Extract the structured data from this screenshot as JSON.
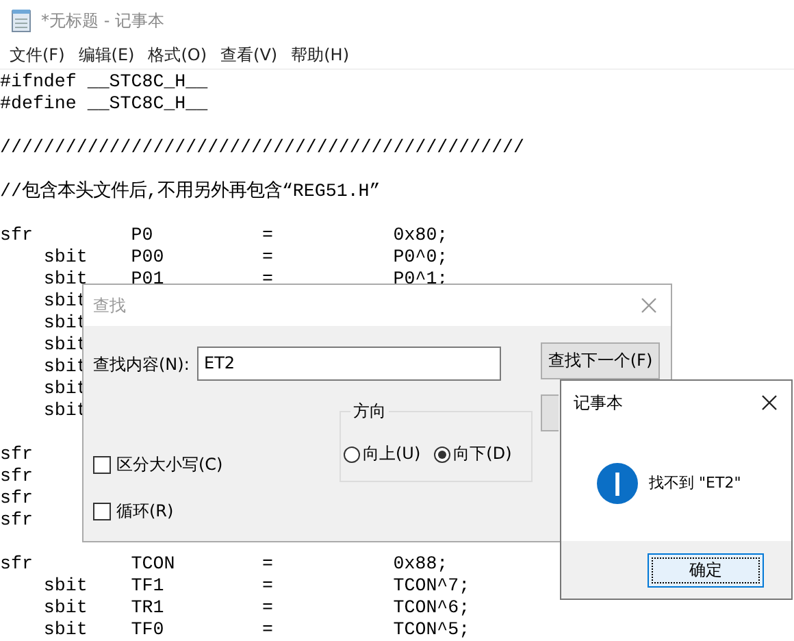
{
  "window": {
    "title": "*无标题 - 记事本"
  },
  "menu": [
    "文件(F)",
    "编辑(E)",
    "格式(O)",
    "查看(V)",
    "帮助(H)"
  ],
  "editor": {
    "blocks": [
      {
        "lines": [
          "#ifndef __STC8C_H__",
          "#define __STC8C_H__"
        ]
      },
      {
        "lines": [
          "////////////////////////////////////////////////"
        ]
      },
      {
        "lines": [
          "//包含本头文件后,不用另外再包含“REG51.H”"
        ]
      },
      {
        "lines": [
          "sfr         P0          =           0x80;",
          "    sbit    P00         =           P0^0;",
          "    sbit    P01         =           P0^1;",
          "    sbit",
          "    sbit",
          "    sbit",
          "    sbit",
          "    sbit",
          "    sbit"
        ]
      },
      {
        "lines": [
          "sfr",
          "sfr",
          "sfr",
          "sfr"
        ]
      },
      {
        "lines": [
          "sfr         TCON        =           0x88;",
          "    sbit    TF1         =           TCON^7;",
          "    sbit    TR1         =           TCON^6;",
          "    sbit    TF0         =           TCON^5;"
        ]
      }
    ]
  },
  "find_dialog": {
    "title": "查找",
    "label": "查找内容(N):",
    "value": "ET2",
    "find_next": "查找下一个(F)",
    "direction": {
      "title": "方向",
      "options": [
        {
          "label": "向上(U)",
          "selected": false
        },
        {
          "label": "向下(D)",
          "selected": true
        }
      ]
    },
    "options": [
      {
        "label": "区分大小写(C)",
        "checked": false
      },
      {
        "label": "循环(R)",
        "checked": false
      }
    ]
  },
  "message_box": {
    "title": "记事本",
    "message": "找不到 \"ET2\"",
    "button": "确定"
  }
}
